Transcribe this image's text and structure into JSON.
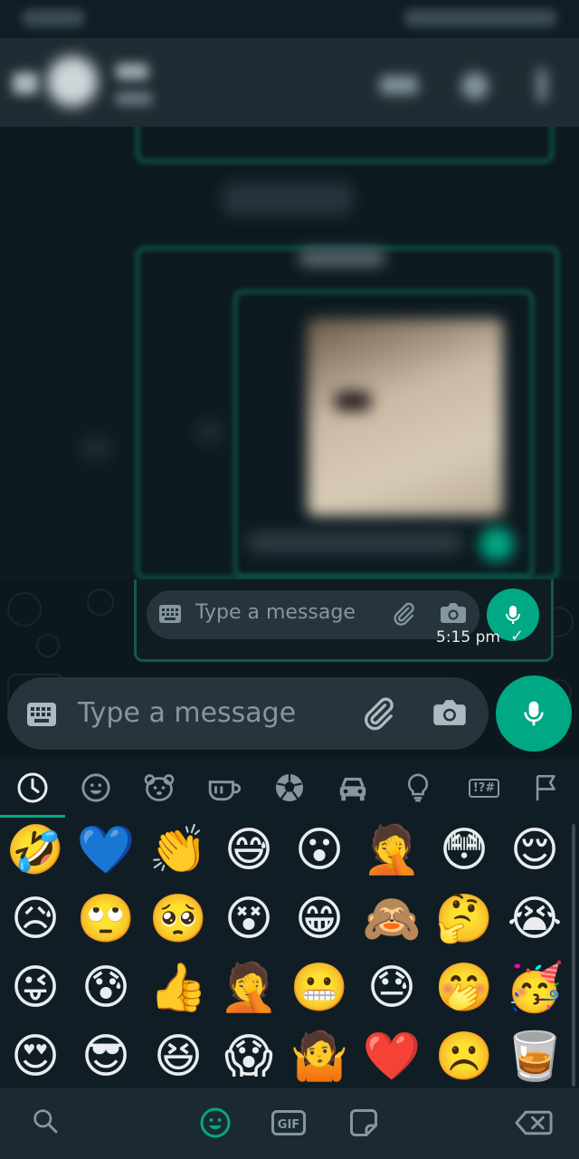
{
  "composer": {
    "mini_placeholder": "Type a message",
    "placeholder": "Type a message"
  },
  "message": {
    "timestamp": "5:15 pm",
    "status_check": "✓"
  },
  "emoji_tabs": [
    {
      "name": "recent-icon",
      "active": true
    },
    {
      "name": "smileys-icon",
      "active": false
    },
    {
      "name": "animals-icon",
      "active": false
    },
    {
      "name": "food-icon",
      "active": false
    },
    {
      "name": "activity-icon",
      "active": false
    },
    {
      "name": "travel-icon",
      "active": false
    },
    {
      "name": "objects-icon",
      "active": false
    },
    {
      "name": "symbols-icon",
      "label": "!?#",
      "active": false
    },
    {
      "name": "flags-icon",
      "active": false
    }
  ],
  "emoji_rows": [
    [
      "🤣",
      "💙",
      "👏",
      "😅",
      "😮",
      "🤦",
      "😳",
      "😌"
    ],
    [
      "😥",
      "🙄",
      "🥺",
      "😵",
      "😁",
      "🙈",
      "🤔",
      "😭"
    ],
    [
      "😜",
      "😰",
      "👍",
      "🤦",
      "😬",
      "😓",
      "🤭",
      "🥳"
    ],
    [
      "😍",
      "😎",
      "😆",
      "😱",
      "🤷",
      "❤️",
      "☹️",
      "🥃"
    ]
  ],
  "bottom_bar": {
    "gif_label": "GIF"
  },
  "colors": {
    "accent": "#00a884",
    "panel_bg": "#101d25",
    "input_bg": "#26343c",
    "placeholder": "#8696a0"
  }
}
